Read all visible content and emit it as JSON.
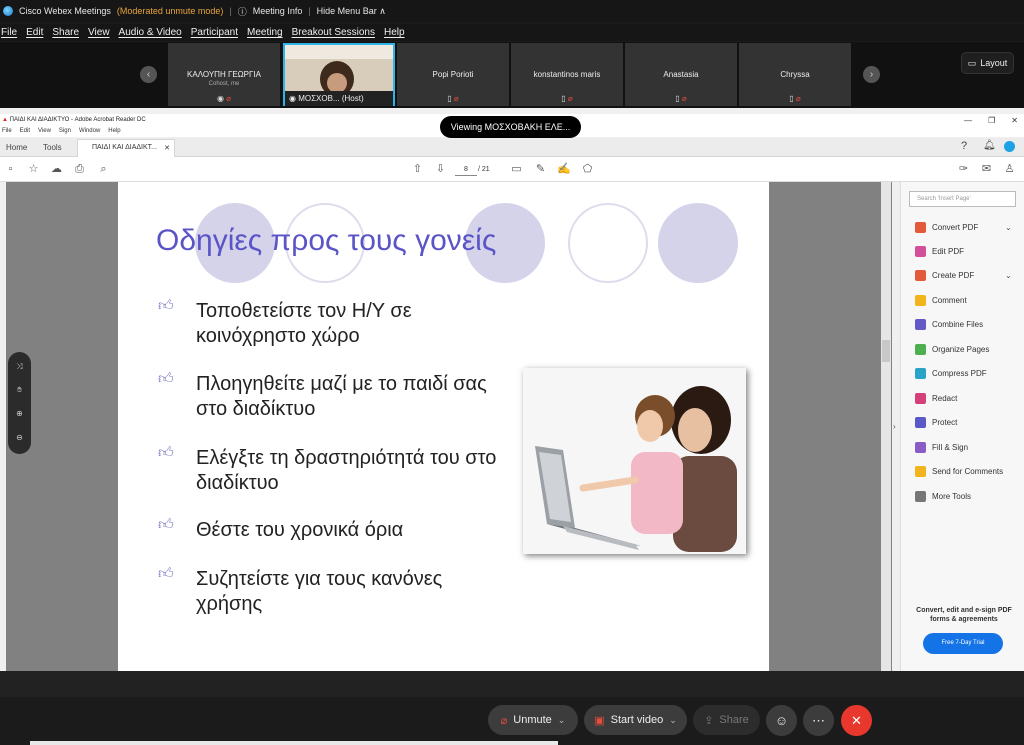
{
  "app": {
    "title": "Cisco Webex Meetings",
    "mode": "(Moderated unmute mode)",
    "meeting_info": "Meeting Info",
    "hide_menu": "Hide Menu Bar ∧"
  },
  "menu": [
    "File",
    "Edit",
    "Share",
    "View",
    "Audio & Video",
    "Participant",
    "Meeting",
    "Breakout Sessions",
    "Help"
  ],
  "participants": [
    {
      "name": "ΚΑΛΟΥΠΗ ΓΕΩΡΓΙΑ",
      "sub": "Cohost, me"
    },
    {
      "name": "ΜΟΣΧΟΒ... (Host)",
      "sub": ""
    },
    {
      "name": "Popi Porioti",
      "sub": ""
    },
    {
      "name": "konstantinos maris",
      "sub": ""
    },
    {
      "name": "Anastasia",
      "sub": ""
    },
    {
      "name": "Chryssa",
      "sub": ""
    }
  ],
  "layout_label": "Layout",
  "viewing_label": "Viewing ΜΟΣΧΟΒΑΚΗ ΕΛΕ...",
  "acrobat": {
    "title": "ΠΑΙΔΙ ΚΑΙ ΔΙΑΔΙΚΤΥΟ - Adobe Acrobat Reader DC",
    "menu": [
      "File",
      "Edit",
      "View",
      "Sign",
      "Window",
      "Help"
    ],
    "tab_home": "Home",
    "tab_tools": "Tools",
    "doc_tab": "ΠΑΙΔΙ ΚΑΙ ΔΙΑΔΙΚΤ...",
    "page_current": "8",
    "page_total": "/ 21",
    "search_placeholder": "Search 'Insert Page'",
    "tools": [
      {
        "label": "Convert PDF",
        "color": "#e35a3b"
      },
      {
        "label": "Edit PDF",
        "color": "#d44f9a"
      },
      {
        "label": "Create PDF",
        "color": "#e35a3b"
      },
      {
        "label": "Comment",
        "color": "#f2b41c"
      },
      {
        "label": "Combine Files",
        "color": "#6459c7"
      },
      {
        "label": "Organize Pages",
        "color": "#4caf50"
      },
      {
        "label": "Compress PDF",
        "color": "#2aa3c9"
      },
      {
        "label": "Redact",
        "color": "#d4407a"
      },
      {
        "label": "Protect",
        "color": "#5b59c8"
      },
      {
        "label": "Fill & Sign",
        "color": "#8a5cc8"
      },
      {
        "label": "Send for Comments",
        "color": "#f2b41c"
      },
      {
        "label": "More Tools",
        "color": "#777777"
      }
    ],
    "promo": "Convert, edit and e-sign PDF forms & agreements",
    "trial": "Free 7-Day Trial"
  },
  "slide": {
    "title": "Οδηγίες προς τους γονείς",
    "bullets": [
      "Τοποθετείστε τον Η/Υ σε κοινόχρηστο χώρο",
      "Πλοηγηθείτε μαζί με το παιδί σας στο διαδίκτυο",
      "Ελέγξτε τη δραστηριότητά του στο διαδίκτυο",
      "Θέστε του χρονικά όρια",
      "Συζητείστε για τους κανόνες χρήσης"
    ]
  },
  "controls": {
    "unmute": "Unmute",
    "start_video": "Start video",
    "share": "Share"
  },
  "colors": {
    "accent_blue": "#1473e6",
    "end_red": "#e8382d",
    "slide_title": "#5a54c6"
  }
}
